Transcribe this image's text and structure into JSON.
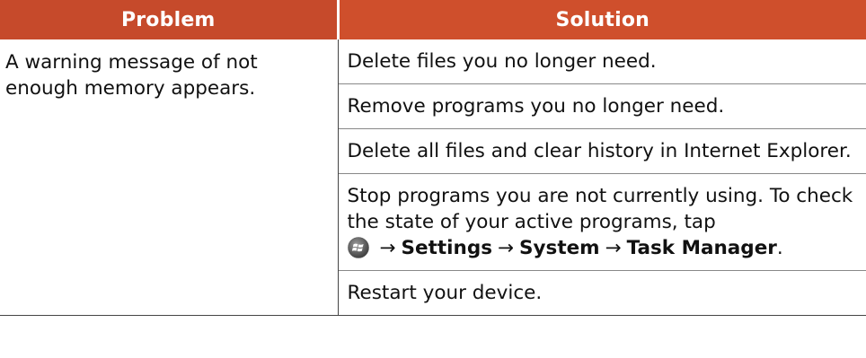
{
  "table": {
    "headers": {
      "problem": "Problem",
      "solution": "Solution"
    },
    "problem_text": "A warning message of not enough memory appears.",
    "solutions": [
      "Delete files you no longer need.",
      "Remove programs you no longer need.",
      "Delete all files and clear history in Internet Explorer.",
      "Stop programs you are not currently using. To check the state of your active programs, tap",
      "Restart your device."
    ],
    "path": {
      "icon": "windows-start-icon",
      "arrow": "→",
      "step1": "Settings",
      "step2": "System",
      "step3": "Task Manager",
      "end": "."
    }
  },
  "colors": {
    "header_bg": "#cf4f2c",
    "header_text": "#ffffff"
  }
}
